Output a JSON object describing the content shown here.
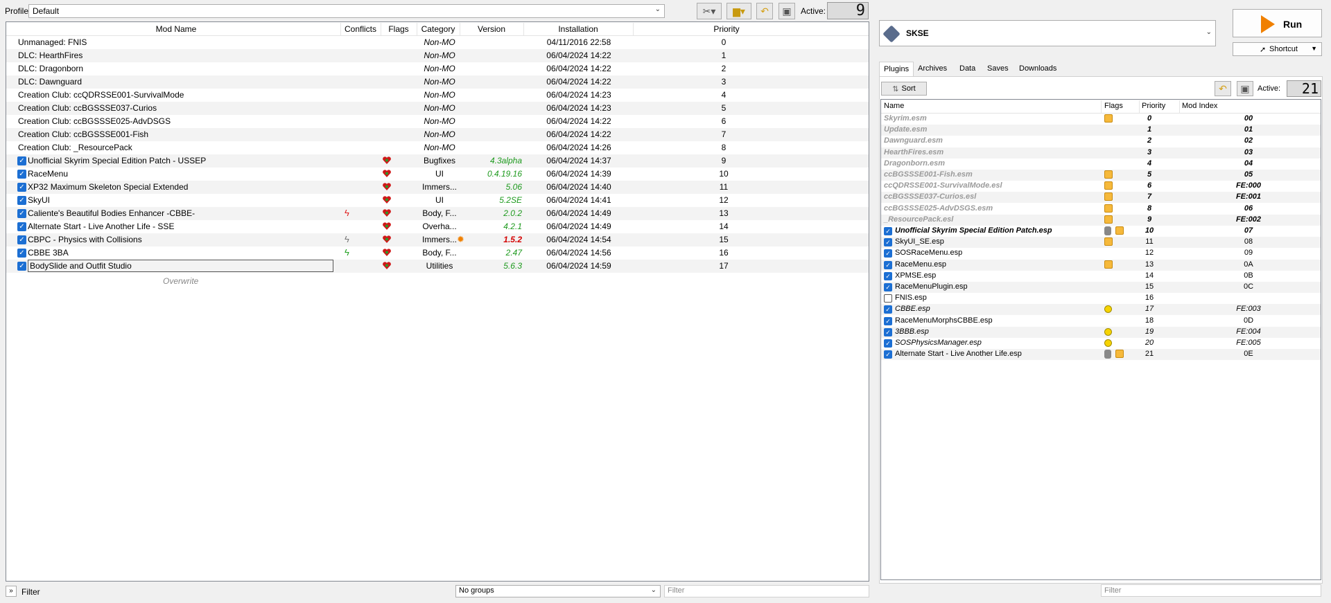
{
  "topbar": {
    "profile_label": "Profile",
    "profile_value": "Default",
    "active_label": "Active:",
    "active_count": "9"
  },
  "modlist": {
    "headers": [
      "Mod Name",
      "Conflicts",
      "Flags",
      "Category",
      "Version",
      "Installation",
      "Priority"
    ],
    "rows": [
      {
        "checked": null,
        "name": "Unmanaged: FNIS",
        "category": "Non-MO",
        "version": "",
        "version_style": "",
        "installation": "04/11/2016 22:58",
        "priority": "0",
        "conflict": "",
        "flag": false,
        "alt": false
      },
      {
        "checked": null,
        "name": "DLC: HearthFires",
        "category": "Non-MO",
        "version": "",
        "version_style": "",
        "installation": "06/04/2024 14:22",
        "priority": "1",
        "conflict": "",
        "flag": false,
        "alt": true
      },
      {
        "checked": null,
        "name": "DLC: Dragonborn",
        "category": "Non-MO",
        "version": "",
        "version_style": "",
        "installation": "06/04/2024 14:22",
        "priority": "2",
        "conflict": "",
        "flag": false,
        "alt": false
      },
      {
        "checked": null,
        "name": "DLC: Dawnguard",
        "category": "Non-MO",
        "version": "",
        "version_style": "",
        "installation": "06/04/2024 14:22",
        "priority": "3",
        "conflict": "",
        "flag": false,
        "alt": true
      },
      {
        "checked": null,
        "name": "Creation Club: ccQDRSSE001-SurvivalMode",
        "category": "Non-MO",
        "version": "",
        "version_style": "",
        "installation": "06/04/2024 14:23",
        "priority": "4",
        "conflict": "",
        "flag": false,
        "alt": false
      },
      {
        "checked": null,
        "name": "Creation Club: ccBGSSSE037-Curios",
        "category": "Non-MO",
        "version": "",
        "version_style": "",
        "installation": "06/04/2024 14:23",
        "priority": "5",
        "conflict": "",
        "flag": false,
        "alt": true
      },
      {
        "checked": null,
        "name": "Creation Club: ccBGSSSE025-AdvDSGS",
        "category": "Non-MO",
        "version": "",
        "version_style": "",
        "installation": "06/04/2024 14:22",
        "priority": "6",
        "conflict": "",
        "flag": false,
        "alt": false
      },
      {
        "checked": null,
        "name": "Creation Club: ccBGSSSE001-Fish",
        "category": "Non-MO",
        "version": "",
        "version_style": "",
        "installation": "06/04/2024 14:22",
        "priority": "7",
        "conflict": "",
        "flag": false,
        "alt": true
      },
      {
        "checked": null,
        "name": "Creation Club: _ResourcePack",
        "category": "Non-MO",
        "version": "",
        "version_style": "",
        "installation": "06/04/2024 14:26",
        "priority": "8",
        "conflict": "",
        "flag": false,
        "alt": false
      },
      {
        "checked": true,
        "name": "Unofficial Skyrim Special Edition Patch - USSEP",
        "category": "Bugfixes",
        "version": "4.3alpha",
        "version_style": "green",
        "installation": "06/04/2024 14:37",
        "priority": "9",
        "conflict": "",
        "flag": true,
        "alt": true
      },
      {
        "checked": true,
        "name": "RaceMenu",
        "category": "UI",
        "version": "0.4.19.16",
        "version_style": "green",
        "installation": "06/04/2024 14:39",
        "priority": "10",
        "conflict": "",
        "flag": true,
        "alt": false
      },
      {
        "checked": true,
        "name": "XP32 Maximum Skeleton Special Extended",
        "category": "Immers...",
        "version": "5.06",
        "version_style": "green",
        "installation": "06/04/2024 14:40",
        "priority": "11",
        "conflict": "",
        "flag": true,
        "alt": true
      },
      {
        "checked": true,
        "name": "SkyUI",
        "category": "UI",
        "version": "5.2SE",
        "version_style": "green",
        "installation": "06/04/2024 14:41",
        "priority": "12",
        "conflict": "",
        "flag": true,
        "alt": false
      },
      {
        "checked": true,
        "name": "Caliente's Beautiful Bodies Enhancer -CBBE-",
        "category": "Body, F...",
        "version": "2.0.2",
        "version_style": "green",
        "installation": "06/04/2024 14:49",
        "priority": "13",
        "conflict": "red",
        "flag": true,
        "alt": true
      },
      {
        "checked": true,
        "name": "Alternate Start - Live Another Life - SSE",
        "category": "Overha...",
        "version": "4.2.1",
        "version_style": "green",
        "installation": "06/04/2024 14:49",
        "priority": "14",
        "conflict": "",
        "flag": true,
        "alt": false
      },
      {
        "checked": true,
        "name": "CBPC - Physics with Collisions",
        "category": "Immers...",
        "version": "1.5.2",
        "version_style": "red",
        "installation": "06/04/2024 14:54",
        "priority": "15",
        "conflict": "grey",
        "flag": true,
        "alt": true
      },
      {
        "checked": true,
        "name": "CBBE 3BA",
        "category": "Body, F...",
        "version": "2.47",
        "version_style": "green",
        "installation": "06/04/2024 14:56",
        "priority": "16",
        "conflict": "green",
        "flag": true,
        "alt": false
      },
      {
        "checked": true,
        "name": "BodySlide and Outfit Studio",
        "category": "Utilities",
        "version": "5.6.3",
        "version_style": "green",
        "installation": "06/04/2024 14:59",
        "priority": "17",
        "conflict": "",
        "flag": true,
        "alt": true
      }
    ],
    "overwrite": "Overwrite"
  },
  "bottombar": {
    "filter_label": "Filter",
    "groups_value": "No groups",
    "filter_placeholder": "Filter"
  },
  "right": {
    "executable": "SKSE",
    "run_label": "Run",
    "shortcut_label": "Shortcut",
    "tabs": [
      "Plugins",
      "Archives",
      "Data",
      "Saves",
      "Downloads"
    ],
    "sort_label": "Sort",
    "active_label": "Active:",
    "active_count": "21",
    "plugin_headers": [
      "Name",
      "Flags",
      "Priority",
      "Mod Index"
    ],
    "plugins": [
      {
        "checked": null,
        "name": "Skyrim.esm",
        "style": "master",
        "flags": [
          "cube"
        ],
        "priority": "0",
        "index": "00"
      },
      {
        "checked": null,
        "name": "Update.esm",
        "style": "master",
        "flags": [],
        "priority": "1",
        "index": "01"
      },
      {
        "checked": null,
        "name": "Dawnguard.esm",
        "style": "master",
        "flags": [],
        "priority": "2",
        "index": "02"
      },
      {
        "checked": null,
        "name": "HearthFires.esm",
        "style": "master",
        "flags": [],
        "priority": "3",
        "index": "03"
      },
      {
        "checked": null,
        "name": "Dragonborn.esm",
        "style": "master",
        "flags": [],
        "priority": "4",
        "index": "04"
      },
      {
        "checked": null,
        "name": "ccBGSSSE001-Fish.esm",
        "style": "master",
        "flags": [
          "cube"
        ],
        "priority": "5",
        "index": "05"
      },
      {
        "checked": null,
        "name": "ccQDRSSE001-SurvivalMode.esl",
        "style": "master",
        "flags": [
          "cube"
        ],
        "priority": "6",
        "index": "FE:000"
      },
      {
        "checked": null,
        "name": "ccBGSSSE037-Curios.esl",
        "style": "master",
        "flags": [
          "cube"
        ],
        "priority": "7",
        "index": "FE:001"
      },
      {
        "checked": null,
        "name": "ccBGSSSE025-AdvDSGS.esm",
        "style": "master",
        "flags": [
          "cube"
        ],
        "priority": "8",
        "index": "06"
      },
      {
        "checked": null,
        "name": "_ResourcePack.esl",
        "style": "master",
        "flags": [
          "cube"
        ],
        "priority": "9",
        "index": "FE:002"
      },
      {
        "checked": true,
        "name": "Unofficial Skyrim Special Edition Patch.esp",
        "style": "bold-it",
        "flags": [
          "lock",
          "cube"
        ],
        "priority": "10",
        "index": "07"
      },
      {
        "checked": true,
        "name": "SkyUI_SE.esp",
        "style": "",
        "flags": [
          "cube"
        ],
        "priority": "11",
        "index": "08"
      },
      {
        "checked": true,
        "name": "SOSRaceMenu.esp",
        "style": "",
        "flags": [],
        "priority": "12",
        "index": "09"
      },
      {
        "checked": true,
        "name": "RaceMenu.esp",
        "style": "",
        "flags": [
          "cube"
        ],
        "priority": "13",
        "index": "0A"
      },
      {
        "checked": true,
        "name": "XPMSE.esp",
        "style": "",
        "flags": [],
        "priority": "14",
        "index": "0B"
      },
      {
        "checked": true,
        "name": "RaceMenuPlugin.esp",
        "style": "",
        "flags": [],
        "priority": "15",
        "index": "0C"
      },
      {
        "checked": false,
        "name": "FNIS.esp",
        "style": "",
        "flags": [],
        "priority": "16",
        "index": ""
      },
      {
        "checked": true,
        "name": "CBBE.esp",
        "style": "esl",
        "flags": [
          "dot"
        ],
        "priority": "17",
        "index": "FE:003"
      },
      {
        "checked": true,
        "name": "RaceMenuMorphsCBBE.esp",
        "style": "",
        "flags": [],
        "priority": "18",
        "index": "0D"
      },
      {
        "checked": true,
        "name": "3BBB.esp",
        "style": "esl",
        "flags": [
          "dot"
        ],
        "priority": "19",
        "index": "FE:004"
      },
      {
        "checked": true,
        "name": "SOSPhysicsManager.esp",
        "style": "esl",
        "flags": [
          "dot"
        ],
        "priority": "20",
        "index": "FE:005"
      },
      {
        "checked": true,
        "name": "Alternate Start - Live Another Life.esp",
        "style": "",
        "flags": [
          "lock",
          "cube"
        ],
        "priority": "21",
        "index": "0E"
      }
    ],
    "filter_placeholder": "Filter"
  },
  "colors": {
    "accent": "#1c6fd3",
    "version_green": "#1e9a1e",
    "version_red": "#d40000",
    "run_orange": "#f08000"
  }
}
